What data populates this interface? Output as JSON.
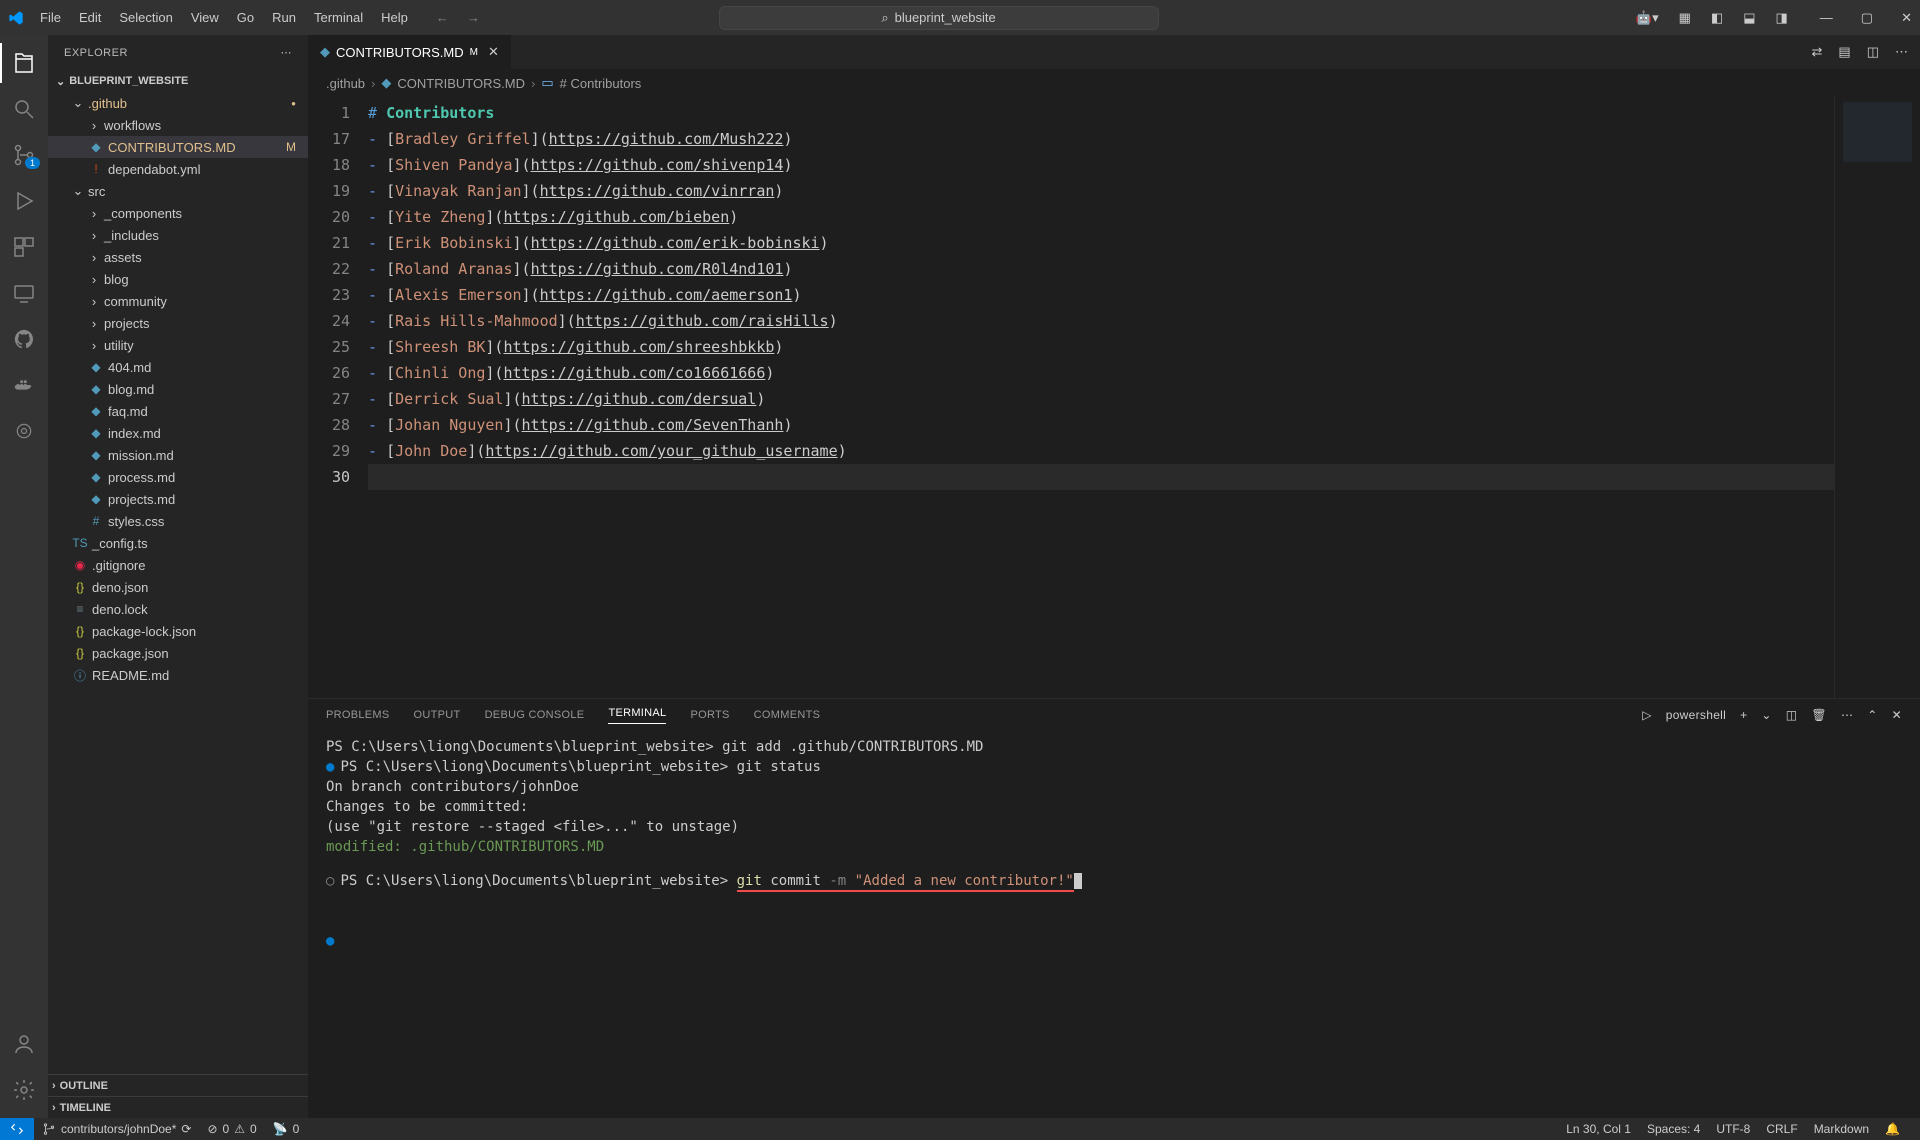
{
  "menu": [
    "File",
    "Edit",
    "Selection",
    "View",
    "Go",
    "Run",
    "Terminal",
    "Help"
  ],
  "search_placeholder": "blueprint_website",
  "explorer": {
    "header": "EXPLORER",
    "project": "BLUEPRINT_WEBSITE",
    "tree": {
      "github": {
        "name": ".github",
        "expanded": true,
        "modified": true
      },
      "workflows": "workflows",
      "contributors_file": "CONTRIBUTORS.MD",
      "contributors_status": "M",
      "dependabot": "dependabot.yml",
      "src": {
        "name": "src",
        "expanded": true
      },
      "src_folders": [
        "_components",
        "_includes",
        "assets",
        "blog",
        "community",
        "projects",
        "utility"
      ],
      "src_files": [
        "404.md",
        "blog.md",
        "faq.md",
        "index.md",
        "mission.md",
        "process.md",
        "projects.md",
        "styles.css"
      ],
      "root_files": [
        "_config.ts",
        ".gitignore",
        "deno.json",
        "deno.lock",
        "package-lock.json",
        "package.json",
        "README.md"
      ]
    },
    "sections": [
      "OUTLINE",
      "TIMELINE"
    ]
  },
  "tab": {
    "name": "CONTRIBUTORS.MD",
    "status": "M"
  },
  "breadcrumb": {
    "p1": ".github",
    "p2": "CONTRIBUTORS.MD",
    "p3": "# Contributors"
  },
  "code": {
    "start_line": 1,
    "heading": {
      "hash": "#",
      "title": "Contributors"
    },
    "lines": [
      {
        "n": 17,
        "name": "Bradley Griffel",
        "url": "https://github.com/Mush222"
      },
      {
        "n": 18,
        "name": "Shiven Pandya",
        "url": "https://github.com/shivenp14"
      },
      {
        "n": 19,
        "name": "Vinayak Ranjan",
        "url": "https://github.com/vinrran"
      },
      {
        "n": 20,
        "name": "Yite Zheng",
        "url": "https://github.com/bieben"
      },
      {
        "n": 21,
        "name": "Erik Bobinski",
        "url": "https://github.com/erik-bobinski"
      },
      {
        "n": 22,
        "name": "Roland Aranas",
        "url": "https://github.com/R0l4nd101"
      },
      {
        "n": 23,
        "name": "Alexis Emerson",
        "url": "https://github.com/aemerson1"
      },
      {
        "n": 24,
        "name": "Rais Hills-Mahmood",
        "url": "https://github.com/raisHills"
      },
      {
        "n": 25,
        "name": "Shreesh BK",
        "url": "https://github.com/shreeshbkkb"
      },
      {
        "n": 26,
        "name": "Chinli Ong",
        "url": "https://github.com/co16661666"
      },
      {
        "n": 27,
        "name": "Derrick Sual",
        "url": "https://github.com/dersual"
      },
      {
        "n": 28,
        "name": "Johan Nguyen",
        "url": "https://github.com/SevenThanh"
      },
      {
        "n": 29,
        "name": "John Doe",
        "url": "https://github.com/your_github_username"
      }
    ],
    "last_line": 30
  },
  "panel": {
    "tabs": [
      "PROBLEMS",
      "OUTPUT",
      "DEBUG CONSOLE",
      "TERMINAL",
      "PORTS",
      "COMMENTS"
    ],
    "active_tab": "TERMINAL",
    "shell_label": "powershell",
    "term": {
      "prompt": "PS C:\\Users\\liong\\Documents\\blueprint_website>",
      "l1_cmd": "git add .github/CONTRIBUTORS.MD",
      "l2_cmd": "git status",
      "l3": "On branch contributors/johnDoe",
      "l4": "Changes to be committed:",
      "l5": "  (use \"git restore --staged <file>...\" to unstage)",
      "l6": "        modified:   .github/CONTRIBUTORS.MD",
      "l7_cmd_git": "git",
      "l7_cmd_commit": "commit",
      "l7_cmd_flag": "-m",
      "l7_cmd_msg": "\"Added a new contributor!\""
    }
  },
  "status": {
    "branch": "contributors/johnDoe*",
    "sync": "⟳",
    "errors": "0",
    "warnings": "0",
    "port": "0",
    "cursor": "Ln 30, Col 1",
    "spaces": "Spaces: 4",
    "encoding": "UTF-8",
    "eol": "CRLF",
    "lang": "Markdown"
  }
}
